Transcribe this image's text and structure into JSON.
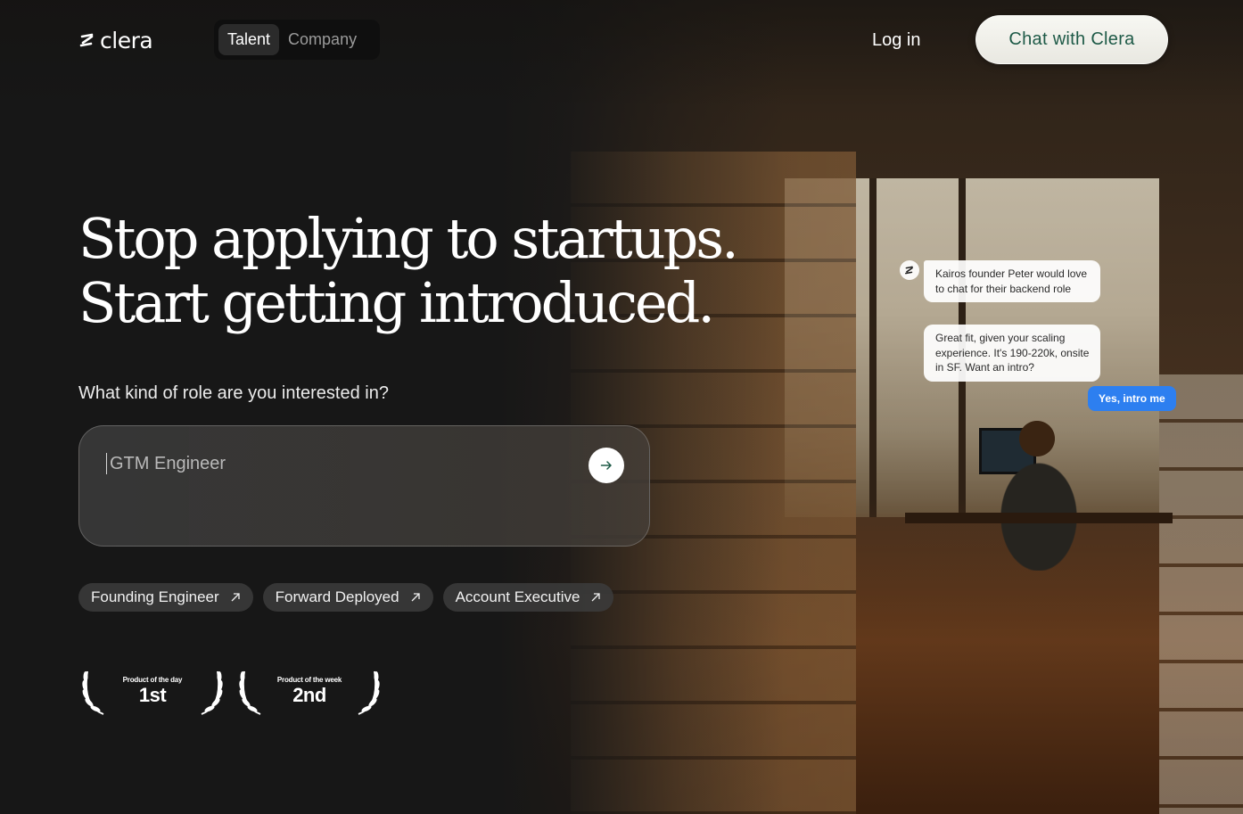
{
  "header": {
    "logo_text": "clera",
    "toggle": [
      {
        "label": "Talent",
        "active": true
      },
      {
        "label": "Company",
        "active": false
      }
    ],
    "login_label": "Log in",
    "cta_label": "Chat with Clera"
  },
  "hero": {
    "headline_line1": "Stop applying to startups.",
    "headline_line2": "Start getting introduced.",
    "question": "What kind of role are you interested in?",
    "input_value": "GTM Engineer",
    "submit_icon": "arrow-right-icon"
  },
  "suggestions": [
    {
      "label": "Founding Engineer",
      "icon": "arrow-up-right-icon"
    },
    {
      "label": "Forward Deployed",
      "icon": "arrow-up-right-icon"
    },
    {
      "label": "Account Executive",
      "icon": "arrow-up-right-icon"
    }
  ],
  "awards": [
    {
      "caption": "Product of the day",
      "rank": "1st"
    },
    {
      "caption": "Product of the week",
      "rank": "2nd"
    }
  ],
  "chat_preview": {
    "messages": [
      "Kairos founder Peter would love to chat for their backend role",
      "Great fit, given your scaling experience. It's 190-220k, onsite in SF. Want an intro?"
    ],
    "reply": "Yes, intro me"
  },
  "colors": {
    "background": "#171717",
    "cta_text": "#1e5a47",
    "reply_bubble": "#2d7ff0"
  }
}
